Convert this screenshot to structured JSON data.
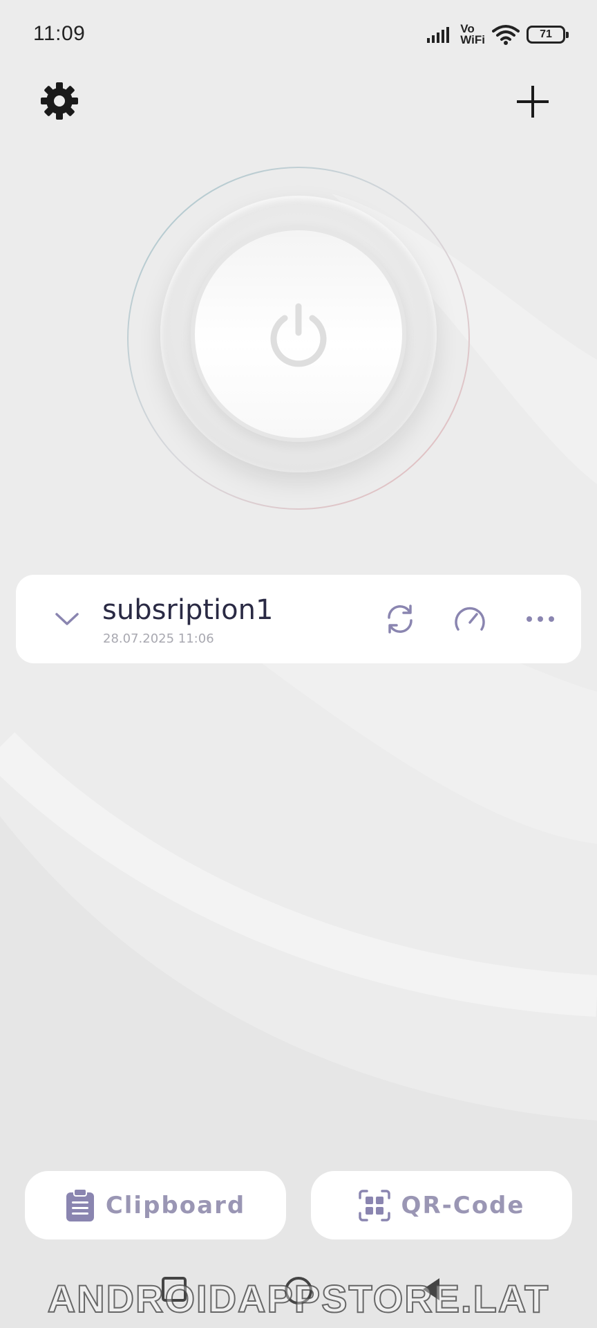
{
  "status_bar": {
    "time": "11:09",
    "network_line1": "Vo",
    "network_line2": "WiFi",
    "battery": "71",
    "icons": [
      "signal-icon",
      "vowifi-icon",
      "wifi-icon",
      "battery-icon"
    ]
  },
  "header": {
    "left_icon": "gear-icon",
    "right_icon": "plus-icon"
  },
  "power": {
    "icon": "power-icon"
  },
  "subscription": {
    "title": "subsription1",
    "date": "28.07.2025 11:06",
    "actions": [
      "refresh-icon",
      "speedometer-icon",
      "more-icon"
    ]
  },
  "actions": {
    "clipboard_label": "Clipboard",
    "qr_label": "QR-Code"
  },
  "nav": {
    "icons": [
      "recents-icon",
      "home-icon",
      "back-icon"
    ]
  },
  "watermark": "ANDROIDAPPSTORE.LAT",
  "colors": {
    "background": "#ececec",
    "card": "#ffffff",
    "accent": "#8a85b0",
    "title": "#2a2a44"
  }
}
